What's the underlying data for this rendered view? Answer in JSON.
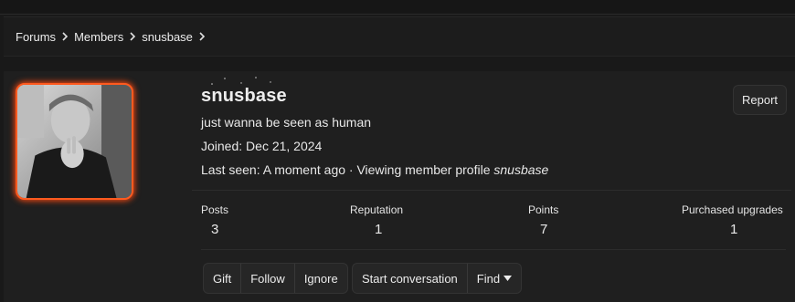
{
  "breadcrumb": {
    "items": [
      "Forums",
      "Members",
      "snusbase"
    ]
  },
  "profile": {
    "username": "snusbase",
    "bio": "just wanna be seen as human",
    "joined_label": "Joined:",
    "joined_date": "Dec 21, 2024",
    "last_seen_label": "Last seen:",
    "last_seen_text": "A moment ago · Viewing member profile",
    "last_seen_target": "snusbase",
    "report_label": "Report"
  },
  "stats": [
    {
      "label": "Posts",
      "value": "3"
    },
    {
      "label": "Reputation",
      "value": "1"
    },
    {
      "label": "Points",
      "value": "7"
    },
    {
      "label": "Purchased upgrades",
      "value": "1"
    }
  ],
  "actions": {
    "group1": [
      "Gift",
      "Follow",
      "Ignore"
    ],
    "group2": [
      "Start conversation",
      "Find"
    ]
  },
  "colors": {
    "avatar_glow": "#ff5a1f",
    "background": "#191919"
  }
}
